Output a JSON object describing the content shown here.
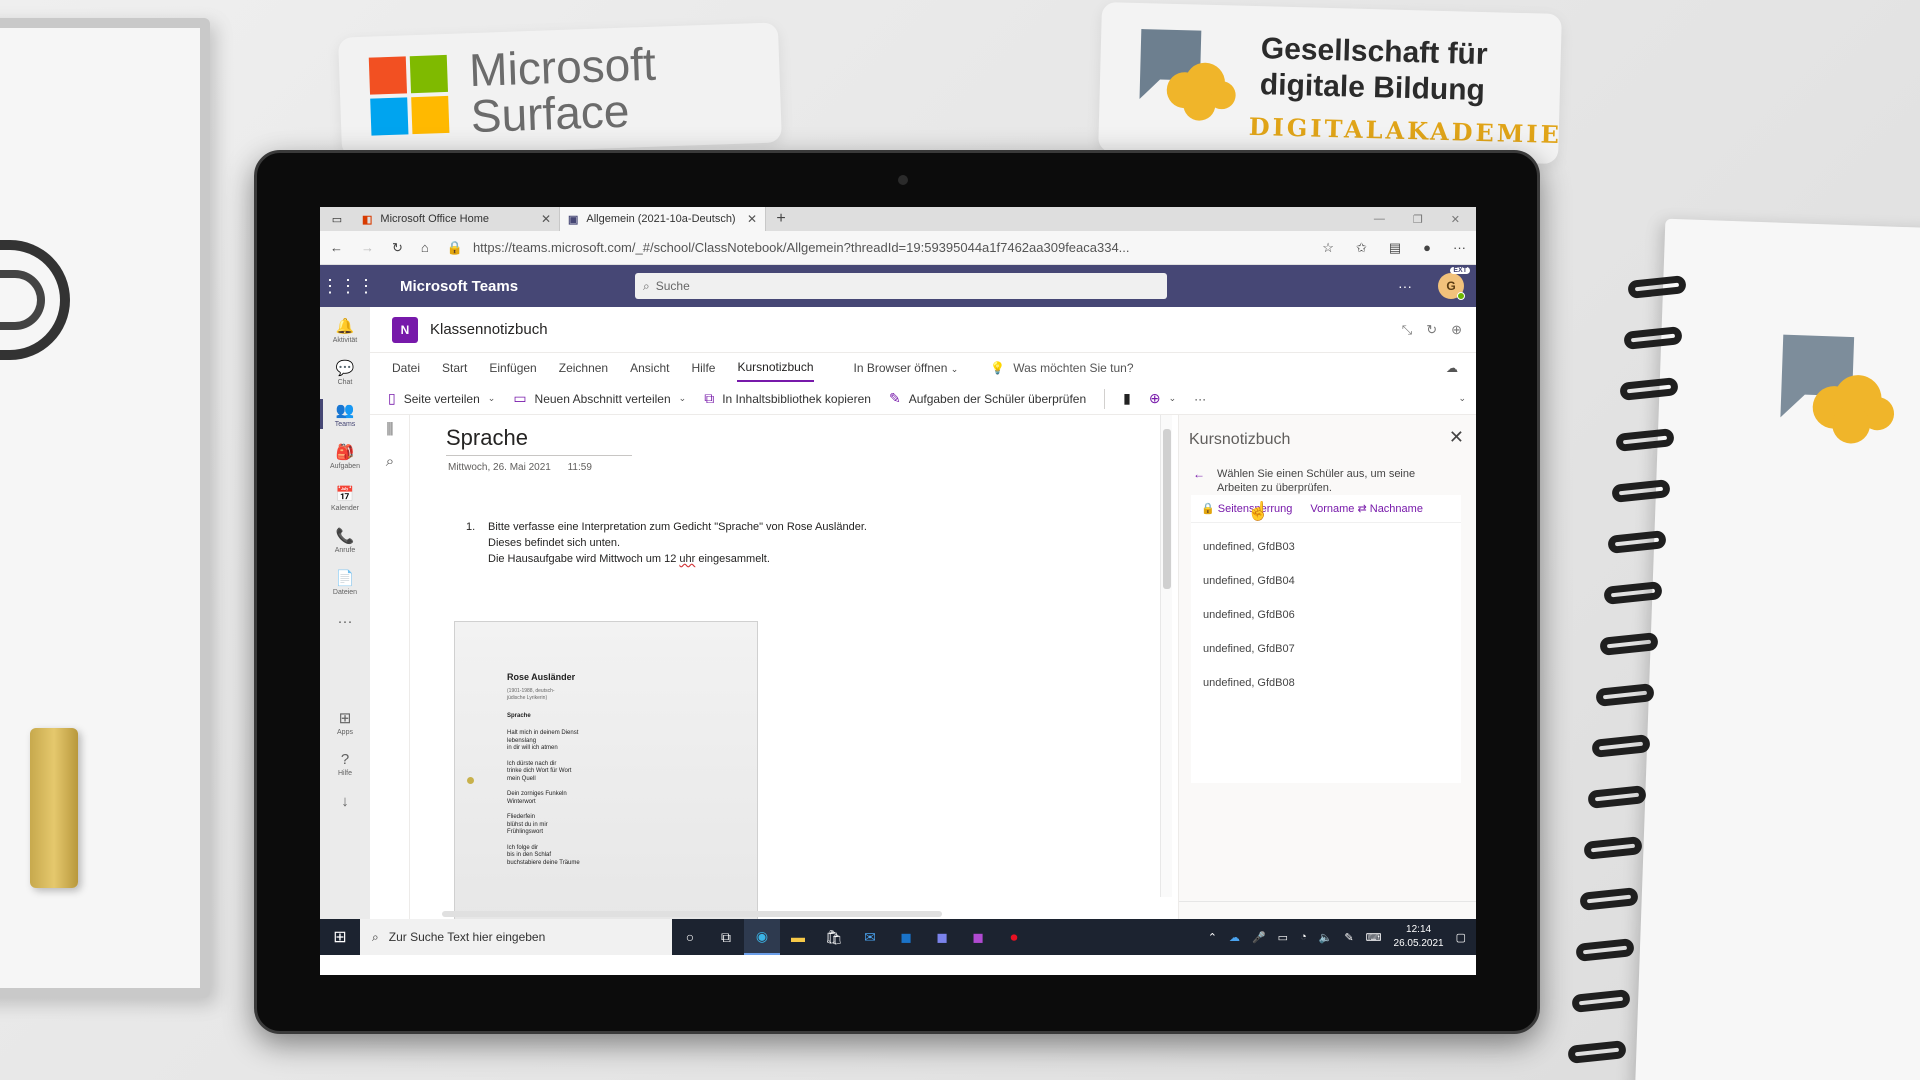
{
  "scene": {
    "microsoft_line1": "Microsoft",
    "microsoft_line2": "Surface",
    "gdb_line1": "Gesellschaft für",
    "gdb_line2": "digitale Bildung",
    "gdb_line3": "DIGITALAKADEMIE"
  },
  "browser": {
    "tabs": [
      {
        "title": "Microsoft Office Home",
        "close": "✕"
      },
      {
        "title": "Allgemein (2021-10a-Deutsch) |",
        "close": "✕"
      }
    ],
    "new_tab": "+",
    "url": "https://teams.microsoft.com/_#/school/ClassNotebook/Allgemein?threadId=19:59395044a1f7462aa309feaca334..."
  },
  "teams": {
    "title": "Microsoft Teams",
    "search_placeholder": "Suche",
    "more": "···",
    "avatar_initial": "G",
    "avatar_badge": "EXT"
  },
  "rail": [
    {
      "label": "Aktivität",
      "icon": "bell-icon",
      "glyph": "🔔"
    },
    {
      "label": "Chat",
      "icon": "chat-icon",
      "glyph": "💬"
    },
    {
      "label": "Teams",
      "icon": "teams-icon",
      "glyph": "👥"
    },
    {
      "label": "Aufgaben",
      "icon": "assignments-icon",
      "glyph": "🎒"
    },
    {
      "label": "Kalender",
      "icon": "calendar-icon",
      "glyph": "📅"
    },
    {
      "label": "Anrufe",
      "icon": "phone-icon",
      "glyph": "📞"
    },
    {
      "label": "Dateien",
      "icon": "file-icon",
      "glyph": "📄"
    },
    {
      "label": "",
      "icon": "more-icon",
      "glyph": "···"
    },
    {
      "label": "Apps",
      "icon": "apps-icon",
      "glyph": "⊞"
    },
    {
      "label": "Hilfe",
      "icon": "help-icon",
      "glyph": "?"
    }
  ],
  "app": {
    "icon_text": "N",
    "title": "Klassennotizbuch"
  },
  "ribbon": {
    "tabs": [
      "Datei",
      "Start",
      "Einfügen",
      "Zeichnen",
      "Ansicht",
      "Hilfe",
      "Kursnotizbuch"
    ],
    "active_tab": "Kursnotizbuch",
    "open_in_browser": "In Browser öffnen",
    "tell_me": "Was möchten Sie tun?",
    "commands": {
      "distribute_page": "Seite verteilen",
      "distribute_section": "Neuen Abschnitt verteilen",
      "copy_library": "In Inhaltsbibliothek kopieren",
      "review_work": "Aufgaben der Schüler überprüfen"
    }
  },
  "page": {
    "title": "Sprache",
    "date": "Mittwoch, 26. Mai 2021",
    "time": "11:59",
    "task_number": "1.",
    "task_line1": "Bitte verfasse eine Interpretation zum Gedicht \"Sprache\" von Rose Ausländer.",
    "task_line2": "Dieses befindet sich unten.",
    "task_line3_pre": "Die Hausaufgabe wird Mittwoch um 12 ",
    "task_line3_uhr": "uhr",
    "task_line3_post": " eingesammelt.",
    "poem": {
      "author": "Rose Ausländer",
      "author_note_1": "(1901-1988, deutsch-",
      "author_note_2": "jüdische Lyrikerin)",
      "title": "Sprache",
      "stanzas": [
        [
          "Halt mich in deinem Dienst",
          "lebenslang",
          "in dir will ich atmen"
        ],
        [
          "Ich dürste nach dir",
          "trinke dich Wort für Wort",
          "mein Quell"
        ],
        [
          "Dein zorniges Funkeln",
          "Winterwort"
        ],
        [
          "Fliederfein",
          "blühst du in mir",
          "Frühlingswort"
        ],
        [
          "Ich folge dir",
          "bis in den Schlaf",
          "buchstabiere  deine Träume"
        ]
      ]
    }
  },
  "panel": {
    "title": "Kursnotizbuch",
    "instruction": "Wählen Sie einen Schüler aus, um seine Arbeiten zu überprüfen.",
    "lock_option": "Seitensperrung",
    "name_sort_first": "Vorname",
    "name_sort_sep": "⇄",
    "name_sort_last": "Nachname",
    "students": [
      "undefined, GfdB03",
      "undefined, GfdB04",
      "undefined, GfdB06",
      "undefined, GfdB07",
      "undefined, GfdB08"
    ]
  },
  "taskbar": {
    "search_placeholder": "Zur Suche Text hier eingeben",
    "time": "12:14",
    "date": "26.05.2021"
  },
  "colors": {
    "teams_purple": "#464775",
    "onenote_purple": "#7719aa",
    "taskbar": "#1c2330"
  }
}
